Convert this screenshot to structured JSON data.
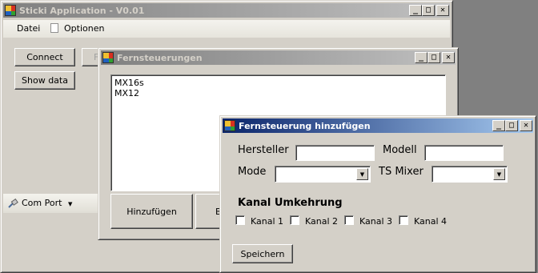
{
  "main_window": {
    "title": "Sticki Application - V0.01",
    "menu": [
      "Datei",
      "Optionen"
    ],
    "connect_label": "Connect",
    "second_button_label": "F",
    "show_data_label": "Show data",
    "status_comport_label": "Com Port"
  },
  "remotes_window": {
    "title": "Fernsteuerungen",
    "list_items": [
      "MX16s",
      "MX12"
    ],
    "add_button_label": "Hinzufügen",
    "second_button_label": "B"
  },
  "add_dialog": {
    "title": "Fernsteuerung hinzufügen",
    "hersteller_label": "Hersteller",
    "hersteller_value": "",
    "modell_label": "Modell",
    "modell_value": "",
    "mode_label": "Mode",
    "mode_value": "",
    "tsmixer_label": "TS Mixer",
    "tsmixer_value": "",
    "section_title": "Kanal Umkehrung",
    "channels": [
      {
        "label": "Kanal 1",
        "checked": false
      },
      {
        "label": "Kanal 2",
        "checked": false
      },
      {
        "label": "Kanal 3",
        "checked": false
      },
      {
        "label": "Kanal 4",
        "checked": false
      }
    ],
    "save_label": "Speichern"
  },
  "window_buttons": {
    "minimize": "_",
    "maximize": "□",
    "close": "✕"
  }
}
